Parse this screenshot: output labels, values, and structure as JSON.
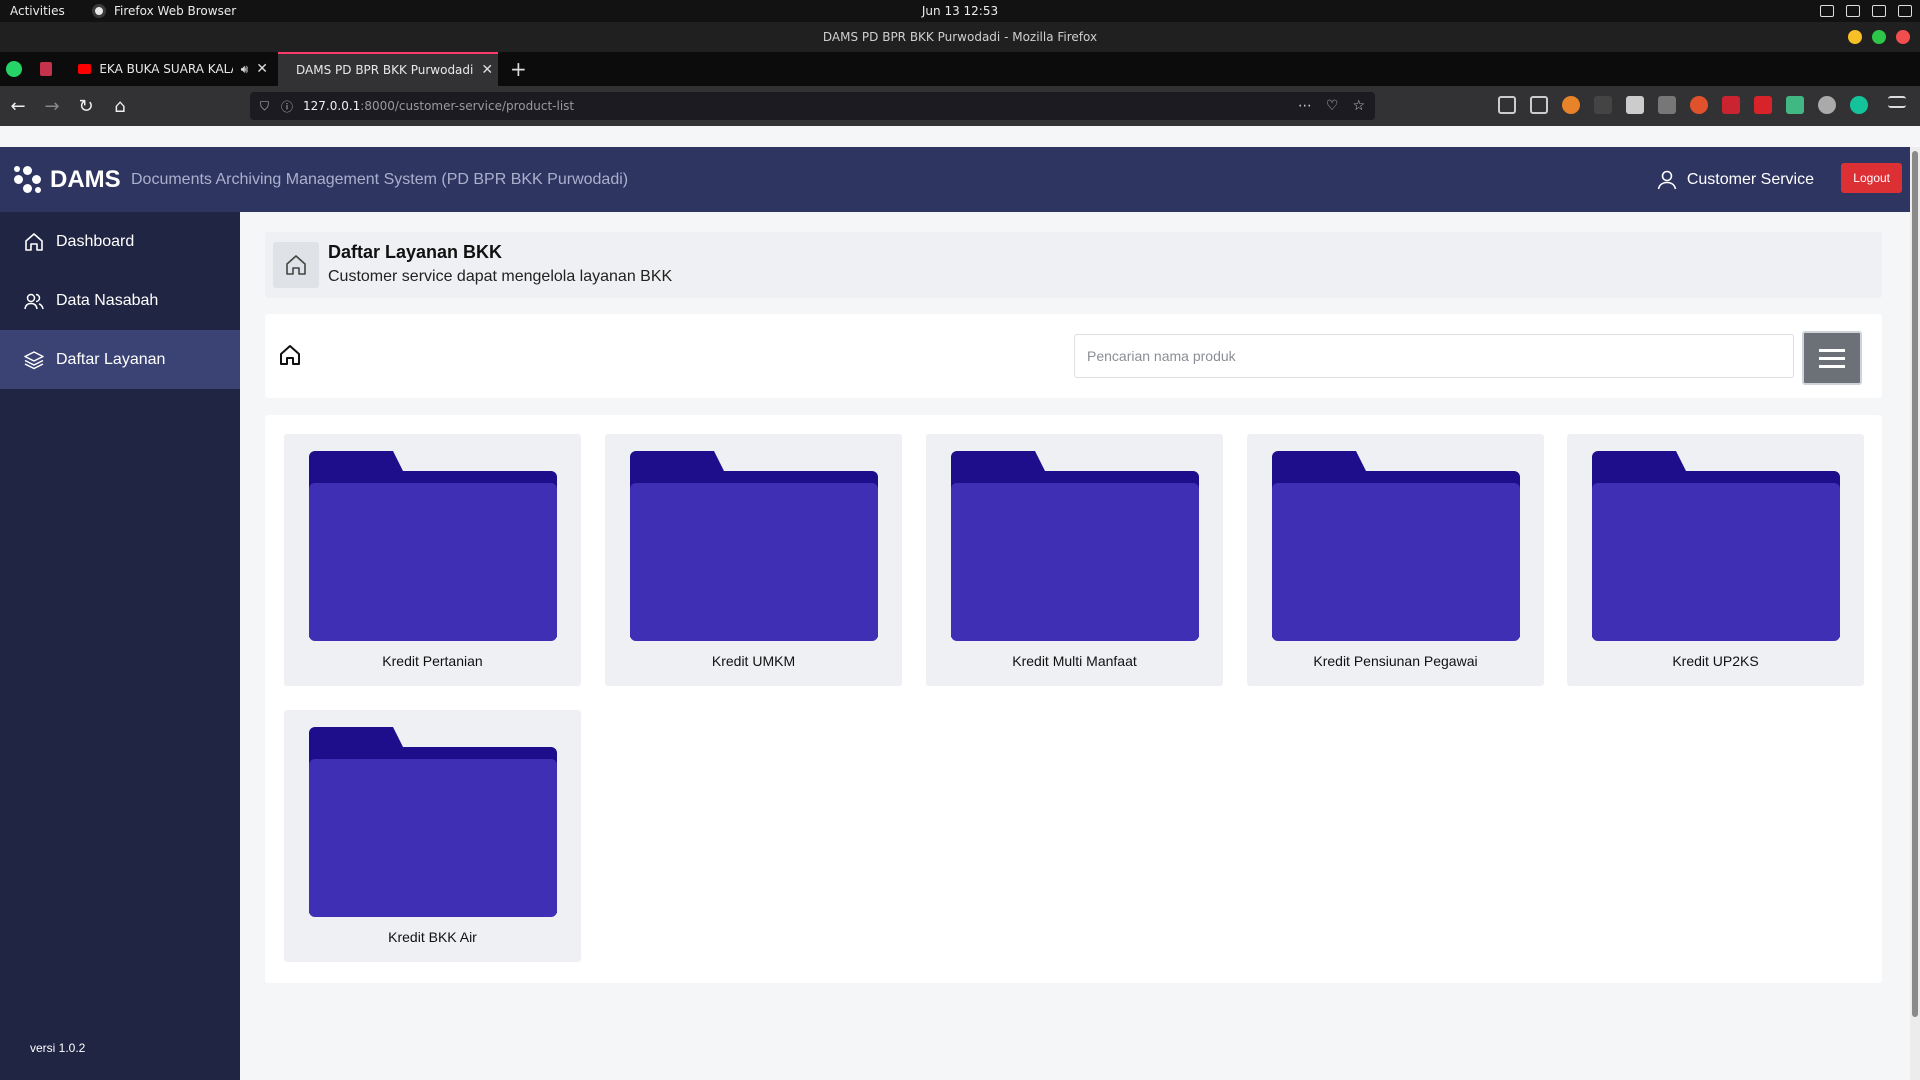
{
  "os": {
    "activities": "Activities",
    "app_name": "Firefox Web Browser",
    "clock": "Jun 13  12:53"
  },
  "window": {
    "title": "DAMS PD BPR BKK Purwodadi - Mozilla Firefox"
  },
  "tabs": [
    {
      "label": "EKA BUKA SUARA KALAU",
      "favicon": "youtube-icon",
      "color": "#ff0000"
    },
    {
      "label": "DAMS PD BPR BKK Purwodadi",
      "favicon": "dams-icon",
      "color": "#d4a017"
    }
  ],
  "browser": {
    "url_host": "127.0.0.1",
    "url_path": ":8000/customer-service/product-list"
  },
  "header": {
    "brand": "DAMS",
    "subtitle": "Documents Archiving Management System (PD BPR BKK Purwodadi)",
    "user": "Customer Service",
    "logout": "Logout"
  },
  "sidebar": {
    "items": [
      {
        "label": "Dashboard",
        "icon": "home-icon"
      },
      {
        "label": "Data Nasabah",
        "icon": "users-icon"
      },
      {
        "label": "Daftar Layanan",
        "icon": "layers-icon"
      }
    ],
    "version": "versi 1.0.2"
  },
  "page": {
    "title": "Daftar Layanan BKK",
    "subtitle": "Customer service dapat mengelola layanan BKK"
  },
  "search": {
    "placeholder": "Pencarian nama produk"
  },
  "products": [
    {
      "label": "Kredit Pertanian"
    },
    {
      "label": "Kredit UMKM"
    },
    {
      "label": "Kredit Multi Manfaat"
    },
    {
      "label": "Kredit Pensiunan Pegawai"
    },
    {
      "label": "Kredit UP2KS"
    },
    {
      "label": "Kredit BKK Air"
    }
  ],
  "colors": {
    "header": "#2e3561",
    "sidebar": "#202543",
    "sidebar_active": "#3b4374",
    "logout": "#dc3035",
    "folder_front": "#3f2fb4",
    "folder_back": "#1e0e8c"
  }
}
